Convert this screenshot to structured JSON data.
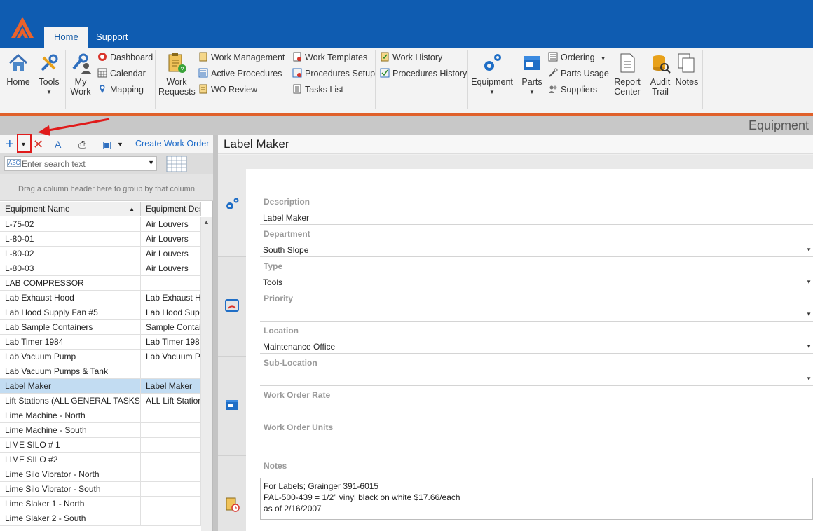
{
  "tabs": [
    {
      "label": "Home"
    },
    {
      "label": "Support"
    }
  ],
  "ribbon": {
    "home": "Home",
    "tools": "Tools",
    "my_work": "My\nWork",
    "my_work_1": "My",
    "my_work_2": "Work",
    "dashboard": "Dashboard",
    "calendar": "Calendar",
    "mapping": "Mapping",
    "work_requests_1": "Work",
    "work_requests_2": "Requests",
    "work_management": "Work Management",
    "active_procedures": "Active Procedures",
    "wo_review": "WO Review",
    "work_templates": "Work Templates",
    "procedures_setup": "Procedures Setup",
    "tasks_list": "Tasks List",
    "work_history": "Work History",
    "procedures_history": "Procedures History",
    "equipment": "Equipment",
    "parts": "Parts",
    "ordering": "Ordering",
    "parts_usage": "Parts Usage",
    "suppliers": "Suppliers",
    "report_center_1": "Report",
    "report_center_2": "Center",
    "audit_trail_1": "Audit",
    "audit_trail_2": "Trail",
    "notes": "Notes"
  },
  "page_title": "Equipment",
  "left": {
    "create_work_order": "Create Work Order",
    "search_placeholder": "Enter search text",
    "group_hint": "Drag a column header here to group by that column",
    "columns": [
      "Equipment Name",
      "Equipment Des"
    ],
    "rows": [
      {
        "name": "L-75-02",
        "desc": "Air Louvers"
      },
      {
        "name": "L-80-01",
        "desc": "Air Louvers"
      },
      {
        "name": "L-80-02",
        "desc": "Air Louvers"
      },
      {
        "name": "L-80-03",
        "desc": "Air Louvers"
      },
      {
        "name": "LAB COMPRESSOR",
        "desc": ""
      },
      {
        "name": "Lab Exhaust Hood",
        "desc": "Lab Exhaust Ho"
      },
      {
        "name": "Lab Hood Supply Fan #5",
        "desc": "Lab Hood Supp"
      },
      {
        "name": "Lab Sample Containers",
        "desc": "Sample Contair"
      },
      {
        "name": "Lab Timer 1984",
        "desc": "Lab Timer 1984"
      },
      {
        "name": "Lab Vacuum Pump",
        "desc": "Lab Vacuum Pu"
      },
      {
        "name": "Lab Vacuum Pumps & Tank",
        "desc": ""
      },
      {
        "name": "Label Maker",
        "desc": "Label Maker"
      },
      {
        "name": "Lift Stations (ALL GENERAL TASKS)",
        "desc": "ALL Lift Station"
      },
      {
        "name": "Lime Machine - North",
        "desc": ""
      },
      {
        "name": "Lime Machine - South",
        "desc": ""
      },
      {
        "name": "LIME SILO # 1",
        "desc": ""
      },
      {
        "name": "LIME SILO #2",
        "desc": ""
      },
      {
        "name": "Lime Silo Vibrator - North",
        "desc": ""
      },
      {
        "name": "Lime Silo Vibrator - South",
        "desc": ""
      },
      {
        "name": "Lime Slaker 1 - North",
        "desc": ""
      },
      {
        "name": "Lime Slaker 2 - South",
        "desc": ""
      }
    ],
    "selected_row": "Label Maker"
  },
  "detail": {
    "title": "Label Maker",
    "fields": {
      "description_label": "Description",
      "description_value": "Label Maker",
      "department_label": "Department",
      "department_value": "South Slope",
      "type_label": "Type",
      "type_value": "Tools",
      "priority_label": "Priority",
      "priority_value": "",
      "location_label": "Location",
      "location_value": "Maintenance Office",
      "sublocation_label": "Sub-Location",
      "sublocation_value": "",
      "wo_rate_label": "Work Order Rate",
      "wo_rate_value": "",
      "wo_units_label": "Work Order Units",
      "wo_units_value": "",
      "notes_label": "Notes",
      "notes_line1": "For Labels; Grainger 391-6015",
      "notes_line2": "PAL-500-439 = 1/2\" vinyl black on white $17.66/each",
      "notes_line3": "as of 2/16/2007"
    }
  },
  "colors": {
    "brand_blue": "#0f5cb1",
    "accent_orange": "#e0602a",
    "selection": "#c2dcf2",
    "annotation_red": "#e01b1b"
  }
}
